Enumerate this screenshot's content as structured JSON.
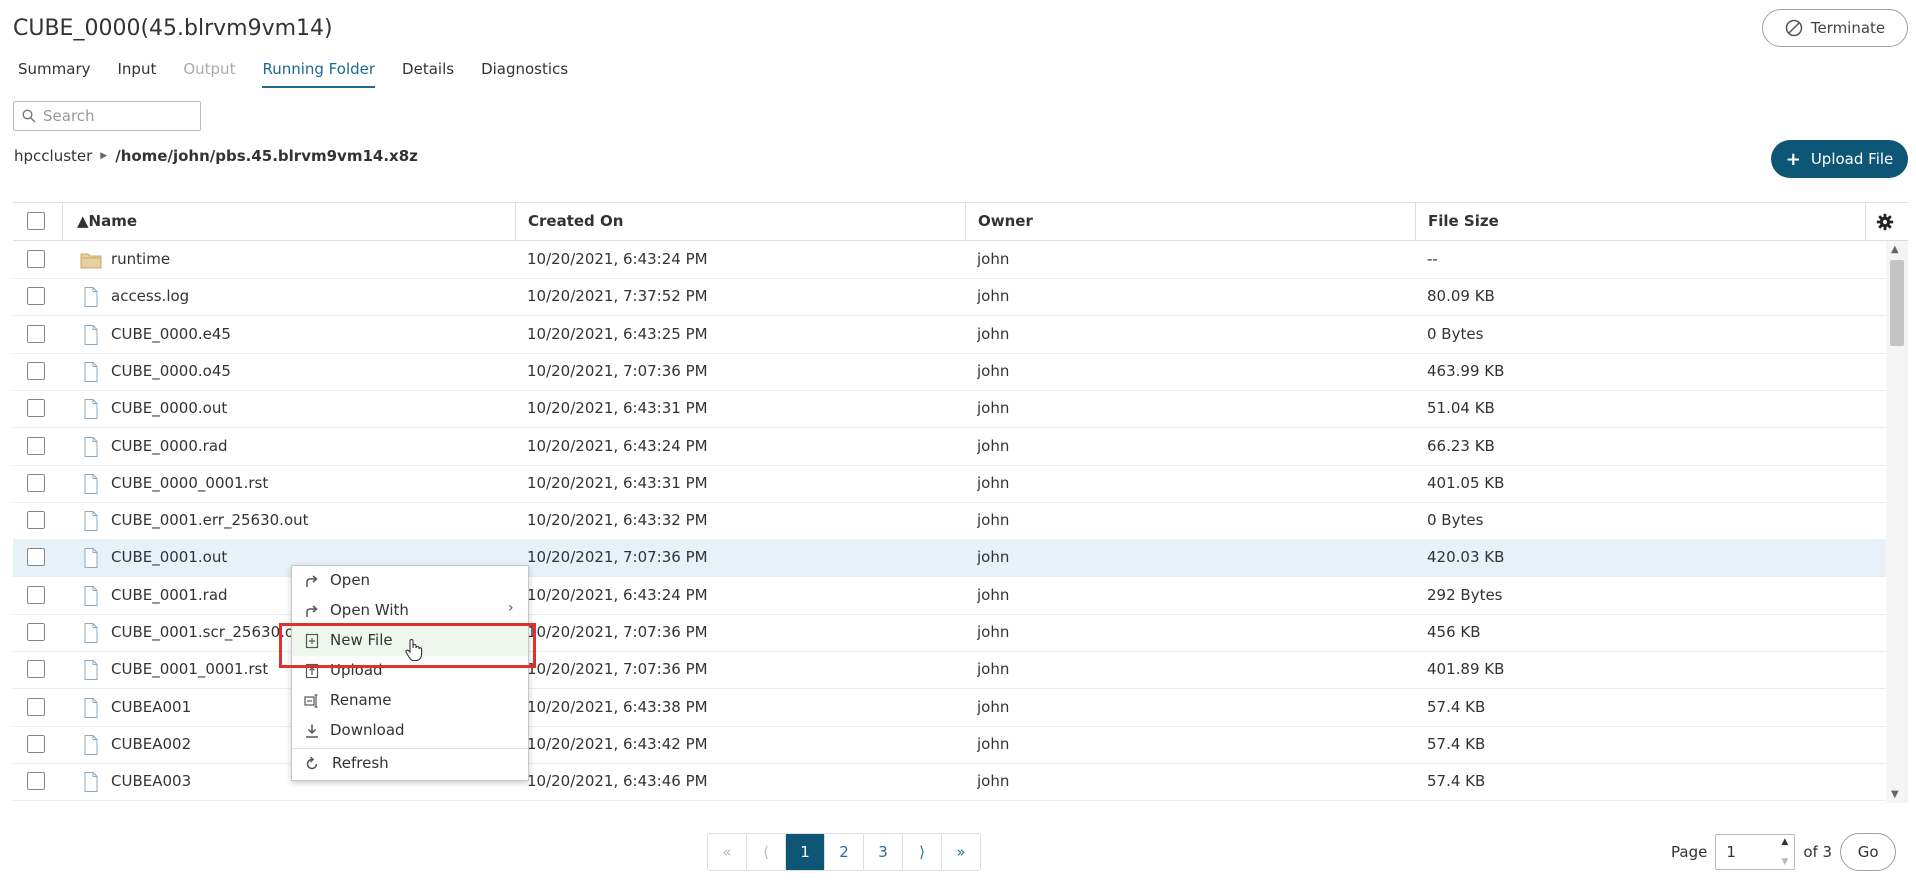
{
  "header": {
    "title": "CUBE_0000(45.blrvm9vm14)",
    "terminate_label": "Terminate"
  },
  "tabs": [
    {
      "label": "Summary",
      "state": "normal"
    },
    {
      "label": "Input",
      "state": "normal"
    },
    {
      "label": "Output",
      "state": "disabled"
    },
    {
      "label": "Running Folder",
      "state": "active"
    },
    {
      "label": "Details",
      "state": "normal"
    },
    {
      "label": "Diagnostics",
      "state": "normal"
    }
  ],
  "search": {
    "placeholder": "Search"
  },
  "breadcrumb": {
    "root": "hpccluster",
    "path": "/home/john/pbs.45.blrvm9vm14.x8z"
  },
  "upload_label": "Upload File",
  "table": {
    "columns": {
      "name": "▲Name",
      "created": "Created On",
      "owner": "Owner",
      "size": "File Size"
    },
    "rows": [
      {
        "name": "runtime",
        "created": "10/20/2021, 6:43:24 PM",
        "owner": "john",
        "size": "--",
        "type": "folder"
      },
      {
        "name": "access.log",
        "created": "10/20/2021, 7:37:52 PM",
        "owner": "john",
        "size": "80.09 KB",
        "type": "file"
      },
      {
        "name": "CUBE_0000.e45",
        "created": "10/20/2021, 6:43:25 PM",
        "owner": "john",
        "size": "0 Bytes",
        "type": "file"
      },
      {
        "name": "CUBE_0000.o45",
        "created": "10/20/2021, 7:07:36 PM",
        "owner": "john",
        "size": "463.99 KB",
        "type": "file"
      },
      {
        "name": "CUBE_0000.out",
        "created": "10/20/2021, 6:43:31 PM",
        "owner": "john",
        "size": "51.04 KB",
        "type": "file"
      },
      {
        "name": "CUBE_0000.rad",
        "created": "10/20/2021, 6:43:24 PM",
        "owner": "john",
        "size": "66.23 KB",
        "type": "file"
      },
      {
        "name": "CUBE_0000_0001.rst",
        "created": "10/20/2021, 6:43:31 PM",
        "owner": "john",
        "size": "401.05 KB",
        "type": "file"
      },
      {
        "name": "CUBE_0001.err_25630.out",
        "created": "10/20/2021, 6:43:32 PM",
        "owner": "john",
        "size": "0 Bytes",
        "type": "file"
      },
      {
        "name": "CUBE_0001.out",
        "created": "10/20/2021, 7:07:36 PM",
        "owner": "john",
        "size": "420.03 KB",
        "type": "file",
        "highlight": true
      },
      {
        "name": "CUBE_0001.rad",
        "created": "10/20/2021, 6:43:24 PM",
        "owner": "john",
        "size": "292 Bytes",
        "type": "file"
      },
      {
        "name": "CUBE_0001.scr_25630.out",
        "created": "10/20/2021, 7:07:36 PM",
        "owner": "john",
        "size": "456 KB",
        "type": "file"
      },
      {
        "name": "CUBE_0001_0001.rst",
        "created": "10/20/2021, 7:07:36 PM",
        "owner": "john",
        "size": "401.89 KB",
        "type": "file"
      },
      {
        "name": "CUBEA001",
        "created": "10/20/2021, 6:43:38 PM",
        "owner": "john",
        "size": "57.4 KB",
        "type": "file"
      },
      {
        "name": "CUBEA002",
        "created": "10/20/2021, 6:43:42 PM",
        "owner": "john",
        "size": "57.4 KB",
        "type": "file"
      },
      {
        "name": "CUBEA003",
        "created": "10/20/2021, 6:43:46 PM",
        "owner": "john",
        "size": "57.4 KB",
        "type": "file"
      }
    ]
  },
  "context_menu": {
    "items": [
      {
        "label": "Open",
        "icon": "open-icon"
      },
      {
        "label": "Open With",
        "icon": "open-with-icon",
        "submenu": true
      },
      {
        "label": "New File",
        "icon": "new-file-icon",
        "hovered": true
      },
      {
        "label": "Upload",
        "icon": "upload-icon"
      },
      {
        "label": "Rename",
        "icon": "rename-icon"
      },
      {
        "label": "Download",
        "icon": "download-icon"
      },
      {
        "label": "Refresh",
        "icon": "refresh-icon"
      }
    ]
  },
  "pagination": {
    "first": "«",
    "prev": "⟨",
    "pages": [
      "1",
      "2",
      "3"
    ],
    "next": "⟩",
    "last": "»",
    "current_page": "1",
    "page_label": "Page",
    "of_label": "of 3",
    "go_label": "Go"
  },
  "colors": {
    "accent": "#0e5675",
    "link": "#2a6f97",
    "highlight_row": "#e7f1f8",
    "callout": "#e0302e"
  }
}
